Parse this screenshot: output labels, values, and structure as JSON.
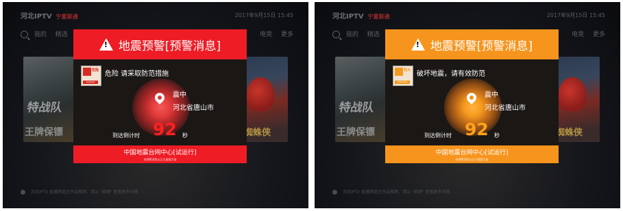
{
  "screens": [
    {
      "theme": "red",
      "brand": "河北IPTV",
      "brand_secondary": "宁夏联通",
      "datetime": "2017年9月15日  15:45",
      "nav": [
        "我的",
        "精选"
      ],
      "nav_right": [
        "电竞",
        "更多"
      ],
      "poster_left_text": "特战队",
      "poster_left_text2": "王牌保镖",
      "poster_right_text": "蜘蛛侠",
      "bottom_tip": "河北IPTV 直播频道已开启推荐，请从 \"按键\" 查看更多详情",
      "dialog": {
        "title": "地震预警[预警消息]",
        "level_badge": "危险",
        "level_sub": "DANGER",
        "message": "危险  请采取防范措施",
        "epicenter_label": "震中",
        "epicenter_place": "河北省唐山市",
        "countdown_label": "到达倒计时",
        "countdown_value": "92",
        "countdown_unit": "秒",
        "footer": "中国地震台网中心[试运行]",
        "footer_sub": "本预警消息以正式速报为准",
        "accent": "#ee1c25"
      }
    },
    {
      "theme": "orange",
      "brand": "河北IPTV",
      "brand_secondary": "宁夏联通",
      "datetime": "2017年9月15日  15:45",
      "nav": [
        "我的",
        "精选"
      ],
      "nav_right": [
        "电竞",
        "更多"
      ],
      "poster_left_text": "特战队",
      "poster_left_text2": "王牌保镖",
      "poster_right_text": "蜘蛛侠",
      "bottom_tip": "河北IPTV 直播频道已开启推荐，请从 \"按键\" 查看更多详情",
      "dialog": {
        "title": "地震预警[预警消息]",
        "level_badge": "较大",
        "level_sub": "WARNING",
        "message": "破坏地震，请有效防范",
        "epicenter_label": "震中",
        "epicenter_place": "河北省唐山市",
        "countdown_label": "到达倒计时",
        "countdown_value": "92",
        "countdown_unit": "秒",
        "footer": "中国地震台网中心[试运行]",
        "footer_sub": "本预警消息以正式速报为准",
        "accent": "#f7941d"
      }
    }
  ]
}
